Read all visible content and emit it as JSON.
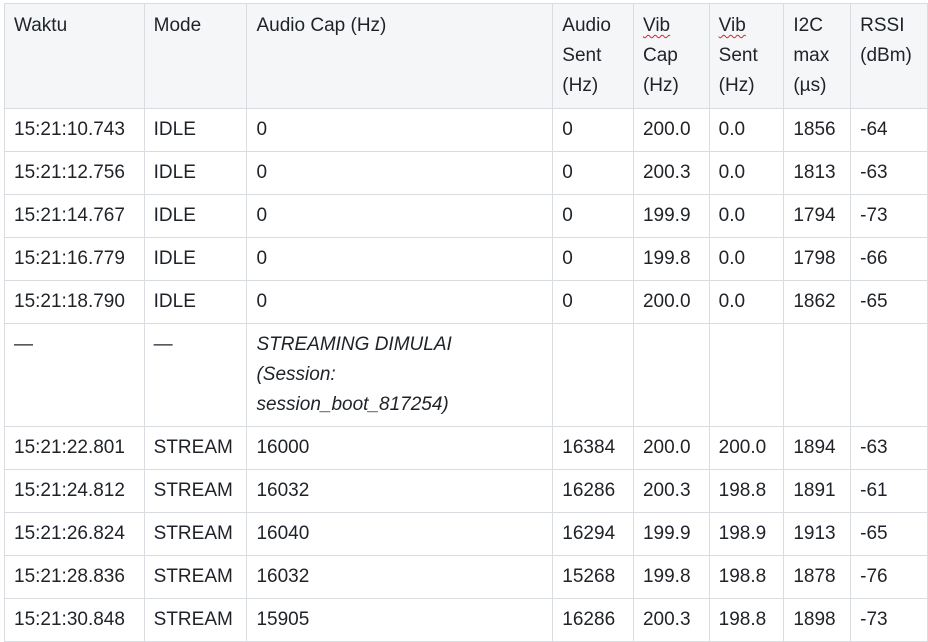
{
  "table": {
    "columns": [
      [
        "Waktu"
      ],
      [
        "Mode"
      ],
      [
        "Audio Cap (Hz)"
      ],
      [
        "Audio",
        "Sent",
        "(Hz)"
      ],
      [
        "Vib",
        "Cap",
        "(Hz)"
      ],
      [
        "Vib",
        "Sent",
        "(Hz)"
      ],
      [
        "I2C",
        "max",
        "(µs)"
      ],
      [
        "RSSI",
        "(dBm)"
      ]
    ],
    "rows_before": [
      [
        "15:21:10.743",
        "IDLE",
        "0",
        "0",
        "200.0",
        "0.0",
        "1856",
        "-64"
      ],
      [
        "15:21:12.756",
        "IDLE",
        "0",
        "0",
        "200.3",
        "0.0",
        "1813",
        "-63"
      ],
      [
        "15:21:14.767",
        "IDLE",
        "0",
        "0",
        "199.9",
        "0.0",
        "1794",
        "-73"
      ],
      [
        "15:21:16.779",
        "IDLE",
        "0",
        "0",
        "199.8",
        "0.0",
        "1798",
        "-66"
      ],
      [
        "15:21:18.790",
        "IDLE",
        "0",
        "0",
        "200.0",
        "0.0",
        "1862",
        "-65"
      ]
    ],
    "event_row": {
      "waktu": "—",
      "mode": "—",
      "note_lines": [
        "STREAMING DIMULAI",
        "(Session:",
        "session_boot_817254)"
      ]
    },
    "rows_after": [
      [
        "15:21:22.801",
        "STREAM",
        "16000",
        "16384",
        "200.0",
        "200.0",
        "1894",
        "-63"
      ],
      [
        "15:21:24.812",
        "STREAM",
        "16032",
        "16286",
        "200.3",
        "198.8",
        "1891",
        "-61"
      ],
      [
        "15:21:26.824",
        "STREAM",
        "16040",
        "16294",
        "199.9",
        "198.9",
        "1913",
        "-65"
      ],
      [
        "15:21:28.836",
        "STREAM",
        "16032",
        "15268",
        "199.8",
        "198.8",
        "1878",
        "-76"
      ],
      [
        "15:21:30.848",
        "STREAM",
        "15905",
        "16286",
        "200.3",
        "198.8",
        "1898",
        "-73"
      ]
    ]
  }
}
